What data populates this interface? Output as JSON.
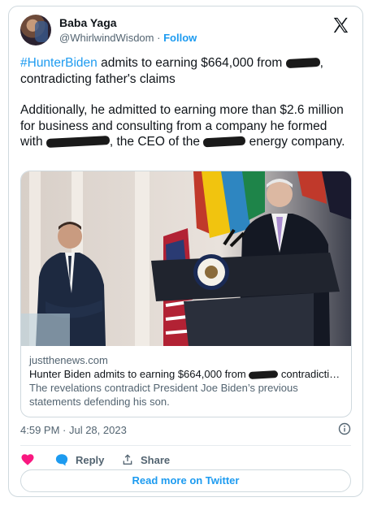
{
  "author": {
    "name": "Baba Yaga",
    "handle": "@WhirlwindWisdom",
    "separator": "·",
    "follow_label": "Follow"
  },
  "tweet": {
    "hashtag": "#HunterBiden",
    "line1_text": " admits to earning $664,000 from ",
    "line1_end": ",",
    "line2_text": "contradicting father's claims",
    "para2_a": "Additionally, he admitted to earning more than $2.6 million for business and consulting from a company he formed with ",
    "para2_b": ", the CEO of the ",
    "para2_c": " energy company."
  },
  "link_card": {
    "domain": "justthenews.com",
    "title_a": "Hunter Biden admits to earning $664,000 from ",
    "title_b": " contradicting fath...",
    "description": "The revelations contradict President Joe Biden’s previous statements defending his son."
  },
  "timestamp": "4:59 PM · Jul 28, 2023",
  "actions": {
    "reply_label": "Reply",
    "share_label": "Share"
  },
  "read_more_label": "Read more on Twitter",
  "colors": {
    "accent": "#1d9bf0",
    "like": "#f91880",
    "text": "#0f1419",
    "secondary": "#536471"
  },
  "icons": [
    "x-logo-icon",
    "info-icon",
    "heart-icon",
    "reply-bubble-icon",
    "share-icon"
  ]
}
